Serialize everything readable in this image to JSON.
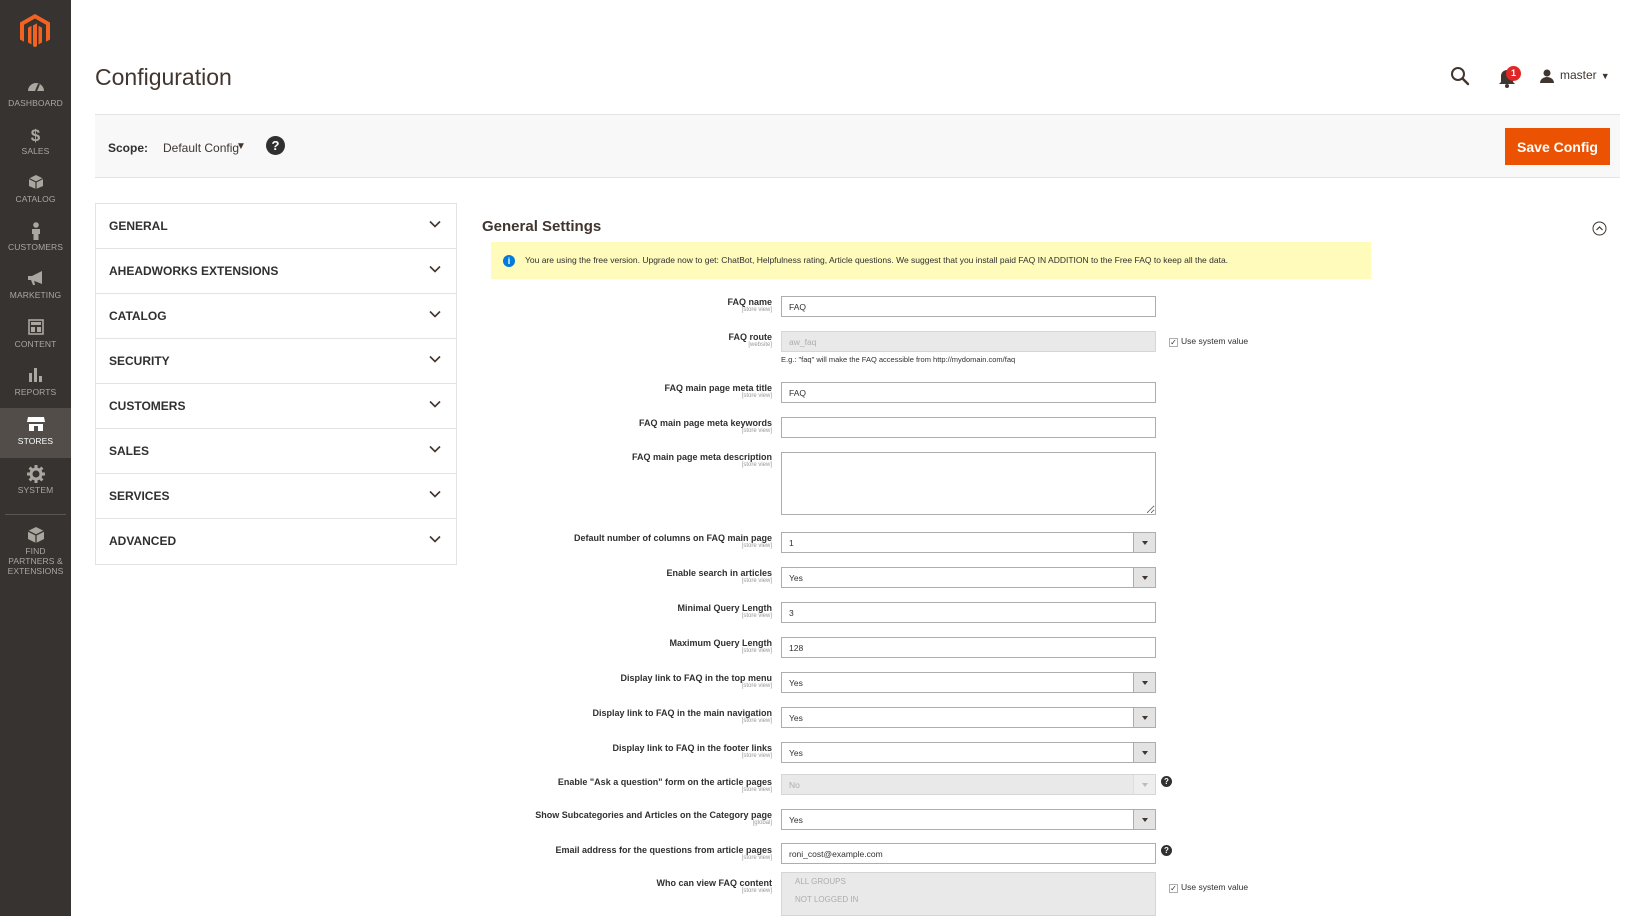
{
  "sidebar": {
    "items": [
      {
        "label": "DASHBOARD",
        "icon": "dashboard-icon"
      },
      {
        "label": "SALES",
        "icon": "dollar-icon"
      },
      {
        "label": "CATALOG",
        "icon": "box-icon"
      },
      {
        "label": "CUSTOMERS",
        "icon": "person-icon"
      },
      {
        "label": "MARKETING",
        "icon": "megaphone-icon"
      },
      {
        "label": "CONTENT",
        "icon": "content-icon"
      },
      {
        "label": "REPORTS",
        "icon": "bar-chart-icon"
      },
      {
        "label": "STORES",
        "icon": "store-icon"
      },
      {
        "label": "SYSTEM",
        "icon": "gear-icon"
      },
      {
        "label": "FIND PARTNERS & EXTENSIONS",
        "icon": "extensions-icon"
      }
    ],
    "active": "STORES"
  },
  "header": {
    "title": "Configuration",
    "notification_count": "1",
    "user": "master"
  },
  "scope": {
    "label": "Scope:",
    "value": "Default Config",
    "help": "?"
  },
  "actions": {
    "save_label": "Save Config"
  },
  "tabs": [
    "GENERAL",
    "AHEADWORKS EXTENSIONS",
    "CATALOG",
    "SECURITY",
    "CUSTOMERS",
    "SALES",
    "SERVICES",
    "ADVANCED"
  ],
  "section": {
    "title": "General Settings",
    "notice": "You are using the free version. Upgrade now to get: ChatBot, Helpfulness rating, Article questions. We suggest that you install paid FAQ IN ADDITION to the Free FAQ to keep all the data."
  },
  "fields": {
    "faq_name": {
      "label": "FAQ name",
      "scope": "[store view]",
      "value": "FAQ"
    },
    "faq_route": {
      "label": "FAQ route",
      "scope": "[website]",
      "value": "aw_faq",
      "note": "E.g.: \"faq\" will make the FAQ accessible from http://mydomain.com/faq",
      "use_system": "Use system value"
    },
    "meta_title": {
      "label": "FAQ main page meta title",
      "scope": "[store view]",
      "value": "FAQ"
    },
    "meta_keywords": {
      "label": "FAQ main page meta keywords",
      "scope": "[store view]",
      "value": ""
    },
    "meta_description": {
      "label": "FAQ main page meta description",
      "scope": "[store view]",
      "value": ""
    },
    "columns": {
      "label": "Default number of columns on FAQ main page",
      "scope": "[store view]",
      "value": "1"
    },
    "search": {
      "label": "Enable search in articles",
      "scope": "[store view]",
      "value": "Yes"
    },
    "min_query": {
      "label": "Minimal Query Length",
      "scope": "[store view]",
      "value": "3"
    },
    "max_query": {
      "label": "Maximum Query Length",
      "scope": "[store view]",
      "value": "128"
    },
    "top_menu": {
      "label": "Display link to FAQ in the top menu",
      "scope": "[store view]",
      "value": "Yes"
    },
    "main_nav": {
      "label": "Display link to FAQ in the main navigation",
      "scope": "[store view]",
      "value": "Yes"
    },
    "footer_links": {
      "label": "Display link to FAQ in the footer links",
      "scope": "[store view]",
      "value": "Yes"
    },
    "ask_question": {
      "label": "Enable \"Ask a question\" form on the article pages",
      "scope": "[store view]",
      "value": "No"
    },
    "subcategories": {
      "label": "Show Subcategories and Articles on the Category page",
      "scope": "[global]",
      "value": "Yes"
    },
    "email": {
      "label": "Email address for the questions from article pages",
      "scope": "[store view]",
      "value": "roni_cost@example.com"
    },
    "who_can_view": {
      "label": "Who can view FAQ content",
      "scope": "[store view]",
      "options": [
        "ALL GROUPS",
        "NOT LOGGED IN"
      ],
      "use_system": "Use system value"
    }
  },
  "colors": {
    "accent": "#eb5202",
    "sidebar": "#373330",
    "notice": "#fffbbb"
  }
}
